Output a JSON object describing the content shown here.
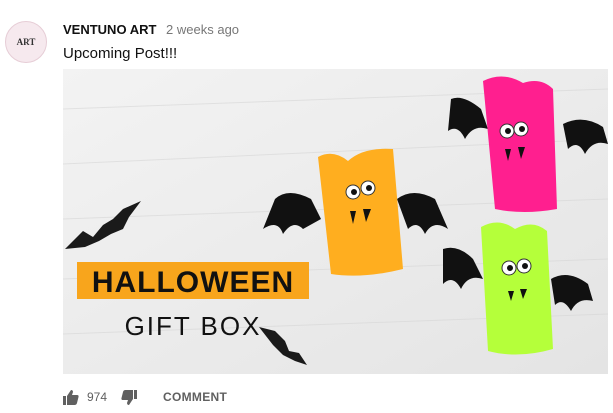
{
  "post": {
    "author": "VENTUNO ART",
    "timestamp": "2 weeks ago",
    "text": "Upcoming Post!!!",
    "avatar_text": "ART"
  },
  "image": {
    "title_line1": "HALLOWEEN",
    "title_line2": "GIFT BOX",
    "colors": {
      "orange": "#ffae1f",
      "pink": "#ff1f8f",
      "green": "#b5ff3a",
      "banner": "#f8a51c"
    }
  },
  "actions": {
    "like_count": "974",
    "comment_label": "COMMENT",
    "like_icon": "thumbs-up-icon",
    "dislike_icon": "thumbs-down-icon"
  }
}
